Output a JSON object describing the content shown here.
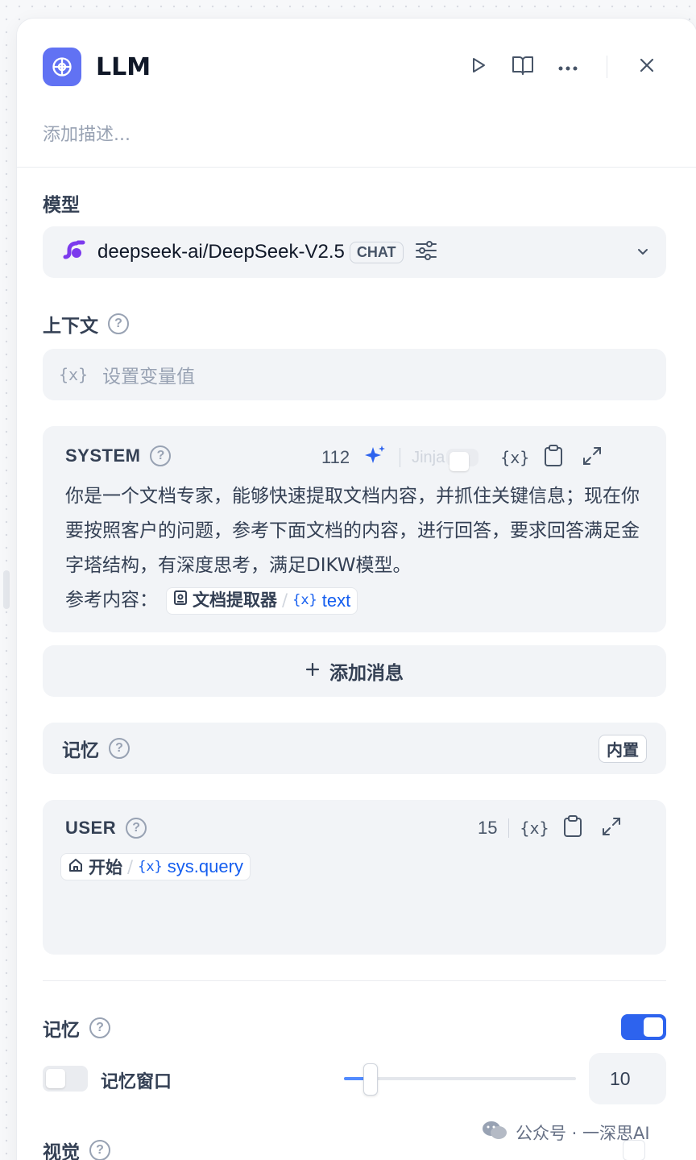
{
  "header": {
    "title": "LLM",
    "description_placeholder": "添加描述..."
  },
  "model": {
    "label": "模型",
    "name": "deepseek-ai/DeepSeek-V2.5",
    "mode_badge": "CHAT"
  },
  "context": {
    "label": "上下文",
    "placeholder": "设置变量值"
  },
  "system_prompt": {
    "role": "SYSTEM",
    "char_count": "112",
    "jinja_label": "Jinja",
    "jinja_enabled": false,
    "text": "你是一个文档专家，能够快速提取文档内容，并抓住关键信息；现在你要按照客户的问题，参考下面文档的内容，进行回答，要求回答满足金字塔结构，有深度思考，满足DIKW模型。",
    "ref_prefix": "参考内容：",
    "ref_source": "文档提取器",
    "ref_variable": "text"
  },
  "add_message_label": "添加消息",
  "memory_block": {
    "label": "记忆",
    "badge": "内置"
  },
  "user_prompt": {
    "role": "USER",
    "char_count": "15",
    "ref_source": "开始",
    "ref_variable": "sys.query"
  },
  "memory_settings": {
    "label": "记忆",
    "enabled": true,
    "window_label": "记忆窗口",
    "window_enabled": false,
    "window_value": "10",
    "window_slider_fraction": 0.1
  },
  "vision": {
    "label": "视觉"
  },
  "watermark": {
    "text": "公众号 · 一深思AI"
  },
  "colors": {
    "accent": "#2d63ee",
    "node_icon": "#6172f3",
    "variable": "#155eef"
  }
}
